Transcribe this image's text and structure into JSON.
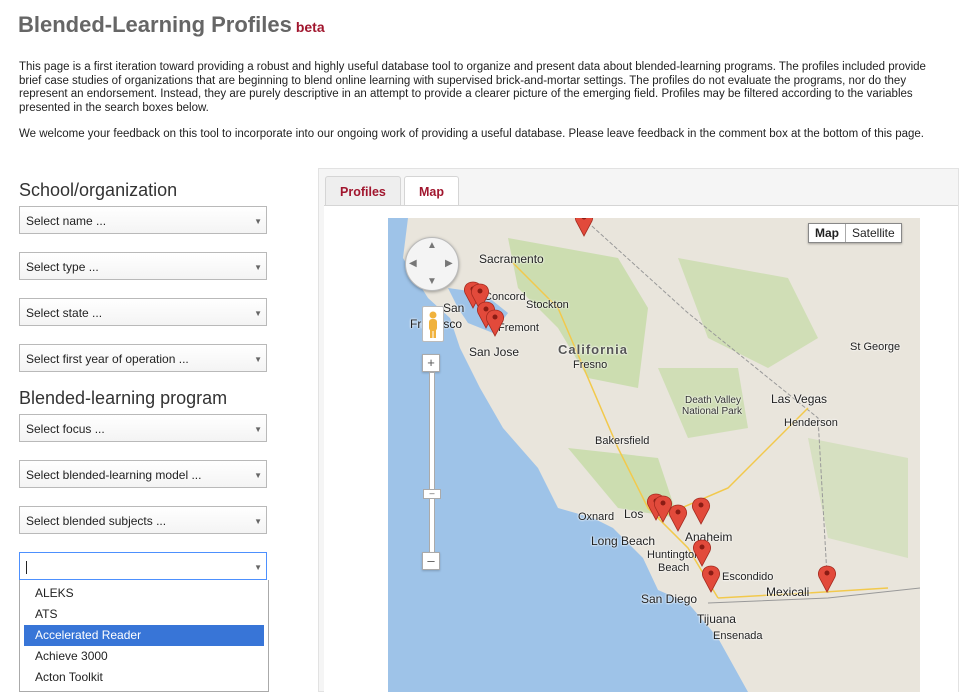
{
  "header": {
    "title": "Blended-Learning Profiles",
    "badge": "beta"
  },
  "intro": {
    "p1": "This page is a first iteration toward providing a robust and highly useful database tool to organize and present data about blended-learning programs. The profiles included provide brief case studies of organizations that are beginning to blend online learning with supervised brick-and-mortar settings. The profiles do not evaluate the programs, nor do they represent an endorsement. Instead, they are purely descriptive in an attempt to provide a clearer picture of the emerging field. Profiles may be filtered according to the variables presented in the search boxes below.",
    "p2": "We welcome your feedback on this tool to incorporate into our ongoing work of providing a useful database. Please leave feedback in the comment box at the bottom of this page."
  },
  "filters": {
    "school_heading": "School/organization",
    "name": "Select name ...",
    "type": "Select type ...",
    "state": "Select state ...",
    "year": "Select first year of operation ...",
    "program_heading": "Blended-learning program",
    "focus": "Select focus ...",
    "model": "Select blended-learning model ...",
    "subjects": "Select blended subjects ...",
    "provider_value": ""
  },
  "dropdown": {
    "options": [
      {
        "label": "ALEKS"
      },
      {
        "label": "ATS"
      },
      {
        "label": "Accelerated Reader"
      },
      {
        "label": "Achieve 3000"
      },
      {
        "label": "Acton Toolkit"
      }
    ],
    "highlighted_color": "#3875d7"
  },
  "tabs": {
    "profiles": "Profiles",
    "map": "Map"
  },
  "map": {
    "type_map": "Map",
    "type_satellite": "Satellite",
    "labels": {
      "sacramento": "Sacramento",
      "concord": "Concord",
      "stockton": "Stockton",
      "san": "San",
      "francisco": "Francisco",
      "fremont": "Fremont",
      "san_jose": "San Jose",
      "california": "California",
      "fresno": "Fresno",
      "st_george": "St George",
      "death_valley": "Death Valley",
      "national_park": "National Park",
      "las_vegas": "Las Vegas",
      "henderson": "Henderson",
      "bakersfield": "Bakersfield",
      "oxnard": "Oxnard",
      "los": "Los",
      "anaheim": "Anaheim",
      "long_beach": "Long Beach",
      "huntington": "Huntington",
      "beach": "Beach",
      "escondido": "Escondido",
      "san_diego": "San Diego",
      "mexicali": "Mexicali",
      "tijuana": "Tijuana",
      "ensenada": "Ensenada"
    },
    "marker_color": "#e24a3b",
    "land_color": "#e9e5dc",
    "water_color": "#9ec3e8",
    "park_color": "#c4dba5"
  }
}
